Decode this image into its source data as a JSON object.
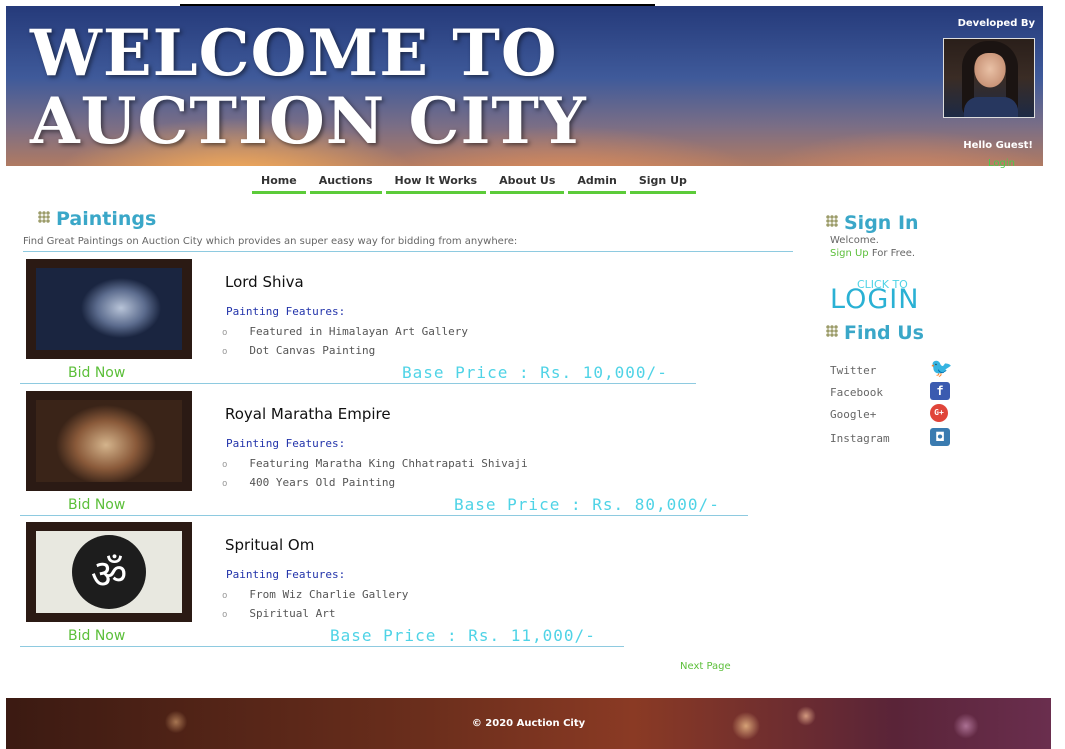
{
  "header": {
    "title_line1": "WELCOME TO",
    "title_line2": "AUCTION CITY",
    "developed_by": "Developed By",
    "greeting": "Hello Guest!",
    "login_link": "Login"
  },
  "nav": {
    "items": [
      "Home",
      "Auctions",
      "How It Works",
      "About Us",
      "Admin",
      "Sign Up"
    ]
  },
  "main": {
    "section_title": "Paintings",
    "description": "Find Great Paintings on Auction City which provides an super easy way for bidding from anywhere:",
    "features_label": "Painting Features:",
    "bid_label": "Bid Now",
    "items": [
      {
        "title": "Lord Shiva",
        "features": [
          "Featured in Himalayan Art Gallery",
          "Dot Canvas Painting"
        ],
        "price": "Base Price : Rs. 10,000/-"
      },
      {
        "title": "Royal Maratha Empire",
        "features": [
          "Featuring Maratha King Chhatrapati Shivaji",
          "400 Years Old Painting"
        ],
        "price": "Base Price : Rs. 80,000/-"
      },
      {
        "title": "Spritual Om",
        "features": [
          "From Wiz Charlie Gallery",
          "Spiritual Art"
        ],
        "price": "Base Price : Rs. 11,000/-"
      }
    ],
    "next_page": "Next Page"
  },
  "sidebar": {
    "signin_title": "Sign In",
    "welcome": "Welcome.",
    "signup_link": "Sign Up",
    "signup_suffix": " For Free.",
    "click_to": "CLICK TO",
    "login_big": "LOGIN",
    "findus_title": "Find Us",
    "social": [
      {
        "label": "Twitter",
        "icon": "twitter-icon"
      },
      {
        "label": "Facebook",
        "icon": "facebook-icon"
      },
      {
        "label": "Google+",
        "icon": "google-plus-icon"
      },
      {
        "label": "Instagram",
        "icon": "instagram-icon"
      }
    ]
  },
  "footer": {
    "text": "© 2020 Auction City"
  }
}
